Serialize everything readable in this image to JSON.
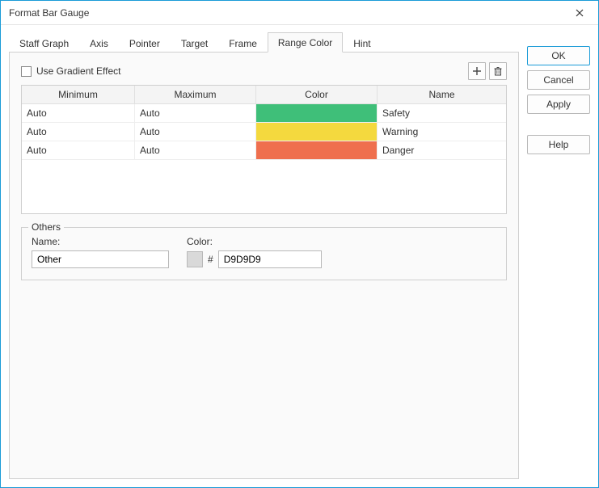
{
  "window": {
    "title": "Format Bar Gauge"
  },
  "tabs": [
    {
      "label": "Staff Graph"
    },
    {
      "label": "Axis"
    },
    {
      "label": "Pointer"
    },
    {
      "label": "Target"
    },
    {
      "label": "Frame"
    },
    {
      "label": "Range Color"
    },
    {
      "label": "Hint"
    }
  ],
  "active_tab": 5,
  "gradient_checkbox": {
    "label": "Use Gradient Effect",
    "checked": false
  },
  "columns": {
    "min": "Minimum",
    "max": "Maximum",
    "color": "Color",
    "name": "Name"
  },
  "rows": [
    {
      "min": "Auto",
      "max": "Auto",
      "color": "#3fbf79",
      "name": "Safety"
    },
    {
      "min": "Auto",
      "max": "Auto",
      "color": "#f4d93e",
      "name": "Warning"
    },
    {
      "min": "Auto",
      "max": "Auto",
      "color": "#ef6f4e",
      "name": "Danger"
    }
  ],
  "others": {
    "legend": "Others",
    "name_label": "Name:",
    "name_value": "Other",
    "color_label": "Color:",
    "hash": "#",
    "hex_value": "D9D9D9",
    "swatch_color": "#D9D9D9"
  },
  "buttons": {
    "ok": "OK",
    "cancel": "Cancel",
    "apply": "Apply",
    "help": "Help"
  }
}
